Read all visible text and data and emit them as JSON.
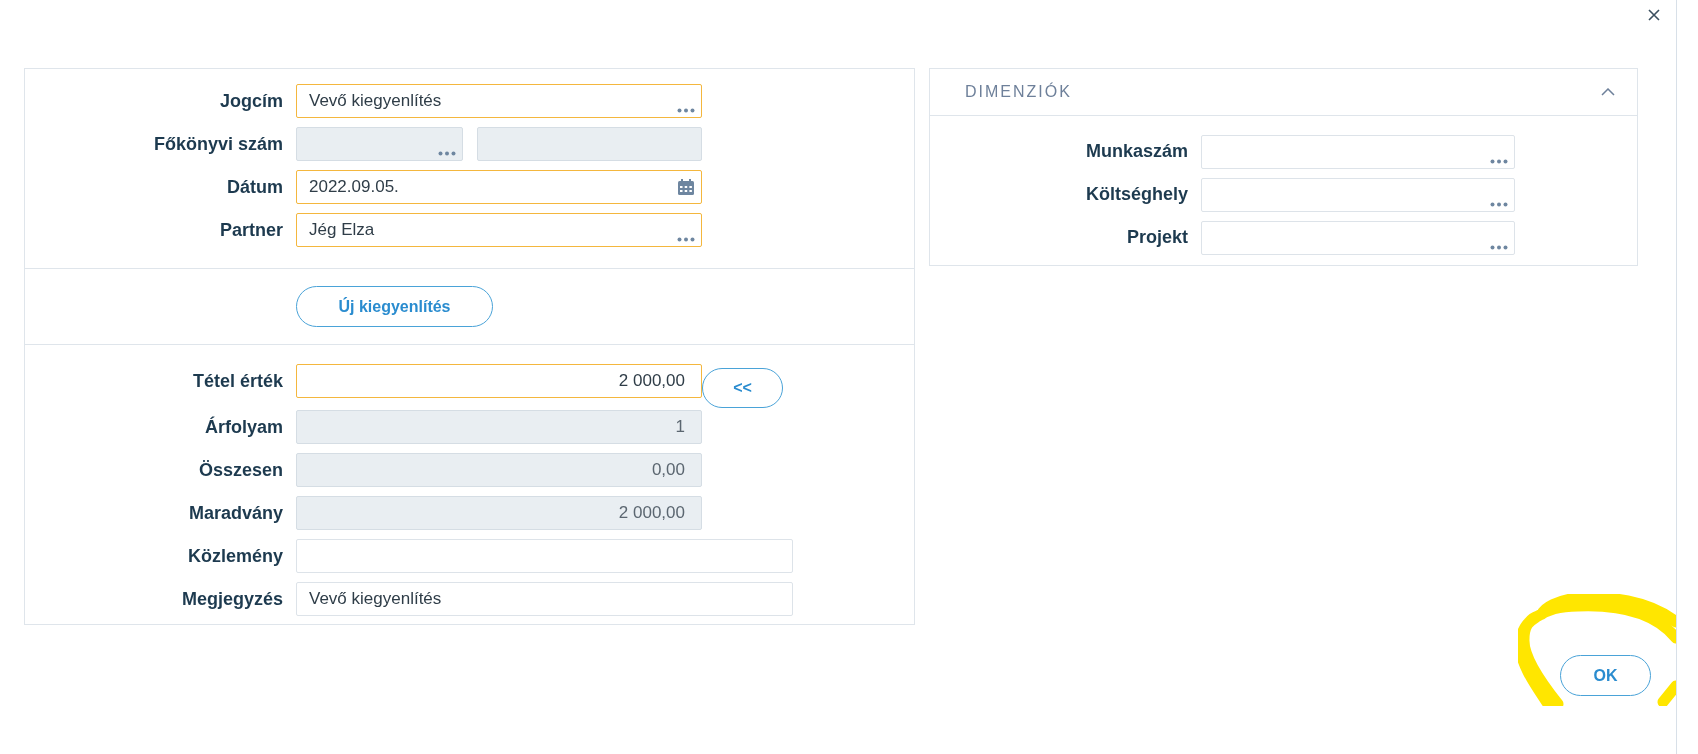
{
  "main_form": {
    "top_fields": [
      {
        "label": "Jogcím",
        "kind": "lookup",
        "value": "Vevő kiegyenlítés",
        "required": true,
        "disabled": false
      },
      {
        "label": "Főkönyvi szám",
        "kind": "split",
        "required": false,
        "disabled": true
      },
      {
        "label": "Dátum",
        "kind": "date",
        "value": "2022.09.05.",
        "required": true,
        "disabled": false
      },
      {
        "label": "Partner",
        "kind": "lookup",
        "value": "Jég Elza",
        "required": true,
        "disabled": false
      }
    ],
    "new_button": "Új kiegyenlítés",
    "amount_fields": [
      {
        "label": "Tétel érték",
        "kind": "number",
        "value": "2 000,00",
        "required": true,
        "disabled": false,
        "action": "<<"
      },
      {
        "label": "Árfolyam",
        "kind": "number",
        "value": "1",
        "required": false,
        "disabled": true
      },
      {
        "label": "Összesen",
        "kind": "number",
        "value": "0,00",
        "required": false,
        "disabled": true
      },
      {
        "label": "Maradvány",
        "kind": "number",
        "value": "2 000,00",
        "required": false,
        "disabled": true
      },
      {
        "label": "Közlemény",
        "kind": "memo",
        "required": false,
        "disabled": false
      },
      {
        "label": "Megjegyzés",
        "kind": "memo",
        "value": "Vevő kiegyenlítés",
        "required": false,
        "disabled": false
      }
    ]
  },
  "dimensions": {
    "title": "DIMENZIÓK",
    "expanded": true,
    "fields": [
      {
        "label": "Munkaszám",
        "kind": "lookup",
        "required": false,
        "disabled": false
      },
      {
        "label": "Költséghely",
        "kind": "lookup",
        "required": false,
        "disabled": false
      },
      {
        "label": "Projekt",
        "kind": "lookup",
        "required": false,
        "disabled": false
      }
    ]
  },
  "ok_button": "OK"
}
